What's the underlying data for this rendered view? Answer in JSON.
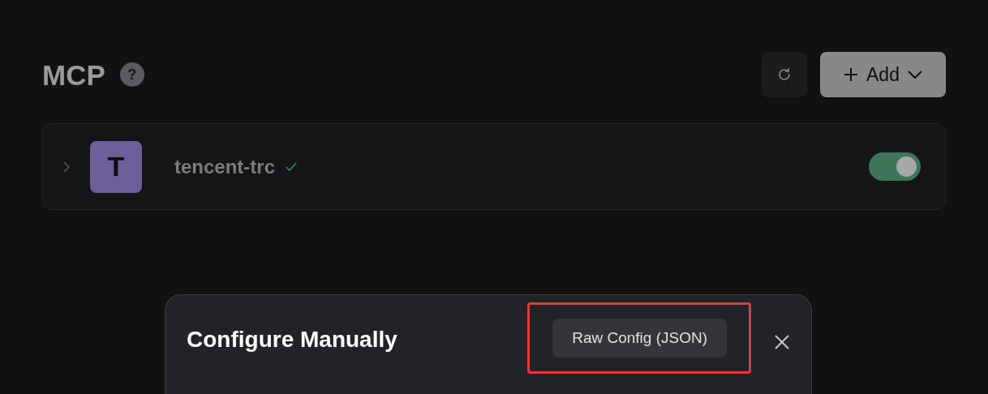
{
  "header": {
    "title": "MCP",
    "help_icon": "?",
    "add_button": {
      "label": "Add"
    }
  },
  "servers": [
    {
      "avatar_letter": "T",
      "color": "#6c5f99",
      "name": "tencent-trc",
      "connected": true,
      "on": true,
      "expanded": false
    }
  ],
  "dialog": {
    "title": "Configure Manually",
    "raw_config_button": "Raw Config (JSON)",
    "highlighted": true
  }
}
